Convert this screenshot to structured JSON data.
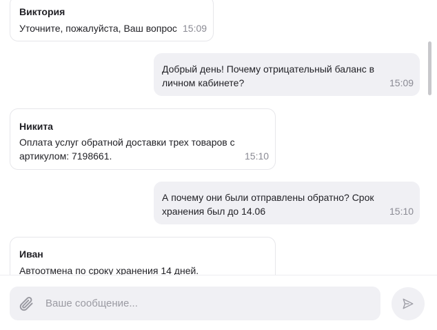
{
  "messages": [
    {
      "direction": "in",
      "author": "Виктория",
      "text": "Уточните, пожалуйста, Ваш вопрос",
      "time": "15:09"
    },
    {
      "direction": "out",
      "text": "Добрый день! Почему отрицательный баланс в личном кабинете?",
      "time": "15:09"
    },
    {
      "direction": "in",
      "author": "Никита",
      "text": "Оплата услуг обратной доставки трех товаров с артикулом: 7198661.",
      "time": "15:10"
    },
    {
      "direction": "out",
      "text": "А почему они были отправлены обратно? Срок хранения был до 14.06",
      "time": "15:10"
    },
    {
      "direction": "in",
      "author": "Иван",
      "text": "Автоотмена по сроку хранения 14 дней."
    }
  ],
  "composer": {
    "placeholder": "Ваше сообщение...",
    "attach_icon": "paperclip-icon",
    "send_icon": "send-icon"
  },
  "colors": {
    "outgoing_bubble": "#f0f0f4",
    "incoming_border": "#e6e6ea",
    "time_text": "#8a8a93"
  }
}
